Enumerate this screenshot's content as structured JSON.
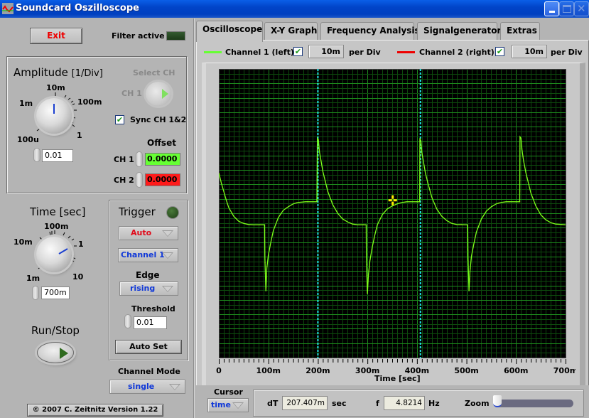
{
  "window": {
    "title": "Soundcard Oszilloscope",
    "controls": [
      "minimize",
      "maximize",
      "close"
    ]
  },
  "left": {
    "exit_label": "Exit",
    "filter_label": "Filter active",
    "filter_led_on": false,
    "amplitude": {
      "title": "Amplitude",
      "unit": "[1/Div]",
      "ticks": [
        "100u",
        "1m",
        "10m",
        "100m",
        "1"
      ],
      "value": "0.01"
    },
    "select_ch": {
      "label": "Select CH",
      "value": "CH 1"
    },
    "sync": {
      "label": "Sync CH 1&2",
      "checked": true
    },
    "offset": {
      "title": "Offset",
      "ch1_label": "CH 1",
      "ch1_value": "0.0000",
      "ch2_label": "CH 2",
      "ch2_value": "0.0000"
    },
    "time": {
      "title": "Time [sec]",
      "ticks": [
        "1m",
        "10m",
        "100m",
        "1",
        "10"
      ],
      "value": "700m"
    },
    "run_stop_label": "Run/Stop",
    "trigger": {
      "title": "Trigger",
      "mode": "Auto",
      "source": "Channel 1",
      "edge_label": "Edge",
      "edge": "rising",
      "threshold_label": "Threshold",
      "threshold": "0.01",
      "autoset_label": "Auto Set"
    },
    "channel_mode": {
      "label": "Channel Mode",
      "value": "single"
    },
    "copyright": "© 2007   C. Zeitnitz Version 1.22"
  },
  "tabs": [
    {
      "label": "Oscilloscope",
      "active": true
    },
    {
      "label": "X-Y Graph",
      "active": false
    },
    {
      "label": "Frequency Analysis",
      "active": false
    },
    {
      "label": "Signalgenerator",
      "active": false
    },
    {
      "label": "Extras",
      "active": false
    }
  ],
  "channels": {
    "ch1": {
      "label": "Channel 1 (left)",
      "checked": true,
      "per_div": "10m",
      "per_div_label": "per Div",
      "color": "#66ff00"
    },
    "ch2": {
      "label": "Channel 2 (right)",
      "checked": true,
      "per_div": "10m",
      "per_div_label": "per Div",
      "color": "#ff0000"
    }
  },
  "chart_data": {
    "type": "line",
    "xlabel": "Time [sec]",
    "ylabel": "",
    "x_ticks": [
      "0",
      "100m",
      "200m",
      "300m",
      "400m",
      "500m",
      "600m",
      "700m"
    ],
    "xlim": [
      0,
      0.7
    ],
    "ylim": [
      -10,
      10
    ],
    "grid": true,
    "series": [
      {
        "name": "Channel 1 (left)",
        "color": "#7cff1a",
        "points": [
          [
            0.0,
            2.8
          ],
          [
            0.005,
            2.1
          ],
          [
            0.01,
            1.5
          ],
          [
            0.015,
            0.9
          ],
          [
            0.02,
            0.4
          ],
          [
            0.03,
            -0.2
          ],
          [
            0.04,
            -0.55
          ],
          [
            0.05,
            -0.7
          ],
          [
            0.06,
            -0.78
          ],
          [
            0.07,
            -0.8
          ],
          [
            0.0925,
            -0.8
          ],
          [
            0.093,
            -3.0
          ],
          [
            0.095,
            -5.4
          ],
          [
            0.097,
            -3.8
          ],
          [
            0.1,
            -2.9
          ],
          [
            0.105,
            -2.0
          ],
          [
            0.11,
            -1.2
          ],
          [
            0.12,
            -0.3
          ],
          [
            0.13,
            0.2
          ],
          [
            0.14,
            0.45
          ],
          [
            0.15,
            0.65
          ],
          [
            0.16,
            0.75
          ],
          [
            0.175,
            0.8
          ],
          [
            0.198,
            0.8
          ],
          [
            0.199,
            5.2
          ],
          [
            0.201,
            5.1
          ],
          [
            0.203,
            4.3
          ],
          [
            0.206,
            3.7
          ],
          [
            0.21,
            2.9
          ],
          [
            0.215,
            2.2
          ],
          [
            0.22,
            1.5
          ],
          [
            0.23,
            0.6
          ],
          [
            0.24,
            0.0
          ],
          [
            0.25,
            -0.4
          ],
          [
            0.26,
            -0.6
          ],
          [
            0.27,
            -0.75
          ],
          [
            0.28,
            -0.8
          ],
          [
            0.2975,
            -0.8
          ],
          [
            0.298,
            -3.0
          ],
          [
            0.3,
            -5.6
          ],
          [
            0.302,
            -4.3
          ],
          [
            0.305,
            -3.3
          ],
          [
            0.31,
            -2.3
          ],
          [
            0.315,
            -1.5
          ],
          [
            0.32,
            -0.8
          ],
          [
            0.33,
            -0.1
          ],
          [
            0.34,
            0.3
          ],
          [
            0.35,
            0.5
          ],
          [
            0.36,
            0.65
          ],
          [
            0.37,
            0.75
          ],
          [
            0.38,
            0.8
          ],
          [
            0.4055,
            0.8
          ],
          [
            0.406,
            5.2
          ],
          [
            0.408,
            5.0
          ],
          [
            0.41,
            4.2
          ],
          [
            0.413,
            3.6
          ],
          [
            0.417,
            2.8
          ],
          [
            0.422,
            2.1
          ],
          [
            0.43,
            1.1
          ],
          [
            0.44,
            0.3
          ],
          [
            0.45,
            -0.2
          ],
          [
            0.46,
            -0.5
          ],
          [
            0.47,
            -0.7
          ],
          [
            0.48,
            -0.78
          ],
          [
            0.5025,
            -0.8
          ],
          [
            0.503,
            -3.0
          ],
          [
            0.505,
            -5.4
          ],
          [
            0.507,
            -4.0
          ],
          [
            0.51,
            -3.0
          ],
          [
            0.515,
            -2.1
          ],
          [
            0.52,
            -1.3
          ],
          [
            0.53,
            -0.4
          ],
          [
            0.54,
            0.15
          ],
          [
            0.55,
            0.45
          ],
          [
            0.56,
            0.65
          ],
          [
            0.57,
            0.75
          ],
          [
            0.58,
            0.8
          ],
          [
            0.6075,
            0.8
          ],
          [
            0.608,
            5.3
          ],
          [
            0.61,
            5.2
          ],
          [
            0.612,
            4.4
          ],
          [
            0.615,
            3.7
          ],
          [
            0.62,
            2.8
          ],
          [
            0.625,
            2.1
          ],
          [
            0.63,
            1.4
          ],
          [
            0.64,
            0.5
          ],
          [
            0.65,
            -0.1
          ],
          [
            0.66,
            -0.45
          ],
          [
            0.67,
            -0.65
          ],
          [
            0.68,
            -0.75
          ],
          [
            0.7,
            -0.8
          ]
        ]
      }
    ],
    "cursors": [
      0.2,
      0.407
    ],
    "cursor_marker": [
      0.351,
      0.9
    ]
  },
  "bottom": {
    "cursor_label": "Cursor",
    "cursor_mode": "time",
    "dt_label": "dT",
    "dt_value": "207.407m",
    "dt_unit": "sec",
    "f_label": "f",
    "f_value": "4.8214",
    "f_unit": "Hz",
    "zoom_label": "Zoom",
    "zoom_value": 0
  }
}
